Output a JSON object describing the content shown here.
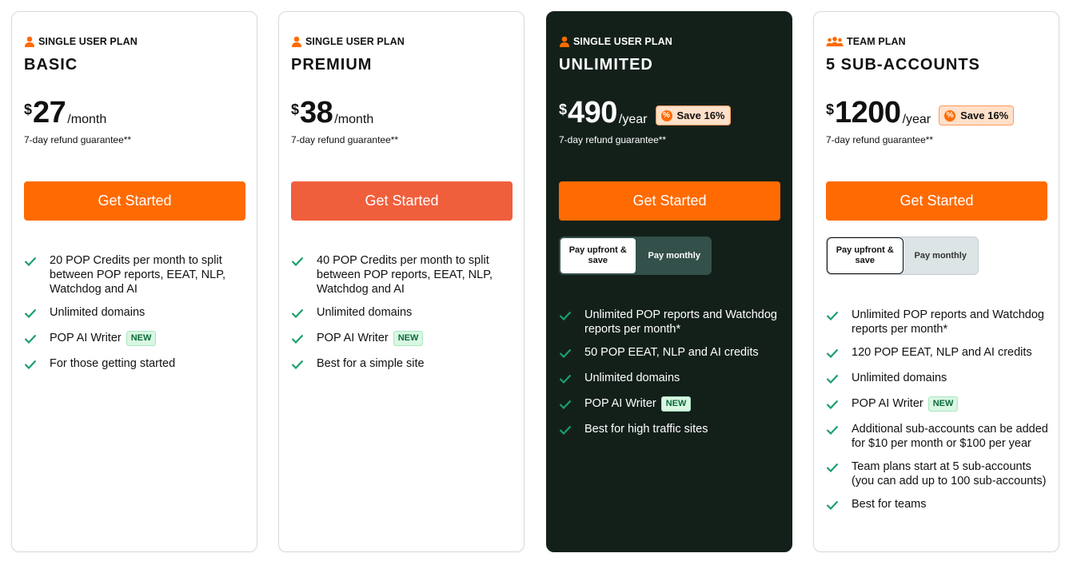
{
  "colors": {
    "accent": "#ff6b00",
    "premium_cta": "#f05f3c",
    "dark_card": "#13201a",
    "check": "#1aa06a"
  },
  "plans": [
    {
      "type_label": "SINGLE USER PLAN",
      "type_icon": "user-icon",
      "name": "BASIC",
      "currency": "$",
      "amount": "27",
      "period": "/month",
      "save": "",
      "refund": "7-day refund guarantee**",
      "cta": "Get Started",
      "features": [
        {
          "text": "20 POP Credits per month to split between POP reports, EEAT, NLP, Watchdog and AI",
          "badge": ""
        },
        {
          "text": "Unlimited domains",
          "badge": ""
        },
        {
          "text": "POP AI Writer",
          "badge": "NEW"
        },
        {
          "text": "For those getting started",
          "badge": ""
        }
      ]
    },
    {
      "type_label": "SINGLE USER PLAN",
      "type_icon": "user-icon",
      "name": "PREMIUM",
      "currency": "$",
      "amount": "38",
      "period": "/month",
      "save": "",
      "refund": "7-day refund guarantee**",
      "cta": "Get Started",
      "features": [
        {
          "text": "40 POP Credits per month to split between POP reports, EEAT, NLP, Watchdog and AI",
          "badge": ""
        },
        {
          "text": "Unlimited domains",
          "badge": ""
        },
        {
          "text": "POP AI Writer",
          "badge": "NEW"
        },
        {
          "text": "Best for a simple site",
          "badge": ""
        }
      ]
    },
    {
      "type_label": "SINGLE USER PLAN",
      "type_icon": "user-icon",
      "name": "UNLIMITED",
      "currency": "$",
      "amount": "490",
      "period": "/year",
      "save": "Save 16%",
      "refund": "7-day refund guarantee**",
      "cta": "Get Started",
      "toggle": {
        "upfront": "Pay upfront & save",
        "monthly": "Pay monthly"
      },
      "features": [
        {
          "text": "Unlimited POP reports and Watchdog reports per month*",
          "badge": ""
        },
        {
          "text": "50 POP EEAT, NLP and AI credits",
          "badge": ""
        },
        {
          "text": "Unlimited domains",
          "badge": ""
        },
        {
          "text": "POP AI Writer",
          "badge": "NEW"
        },
        {
          "text": "Best for high traffic sites",
          "badge": ""
        }
      ]
    },
    {
      "type_label": "TEAM PLAN",
      "type_icon": "team-icon",
      "name": "5 SUB-ACCOUNTS",
      "currency": "$",
      "amount": "1200",
      "period": "/year",
      "save": "Save 16%",
      "refund": "7-day refund guarantee**",
      "cta": "Get Started",
      "toggle": {
        "upfront": "Pay upfront & save",
        "monthly": "Pay monthly"
      },
      "features": [
        {
          "text": "Unlimited POP reports and Watchdog reports per month*",
          "badge": ""
        },
        {
          "text": "120 POP EEAT, NLP and AI credits",
          "badge": ""
        },
        {
          "text": "Unlimited domains",
          "badge": ""
        },
        {
          "text": "POP AI Writer",
          "badge": "NEW"
        },
        {
          "text": "Additional sub-accounts can be added for $10 per month or $100 per year",
          "badge": ""
        },
        {
          "text": "Team plans start at 5 sub-accounts (you can add up to 100 sub-accounts)",
          "badge": ""
        },
        {
          "text": "Best for teams",
          "badge": ""
        }
      ]
    }
  ]
}
